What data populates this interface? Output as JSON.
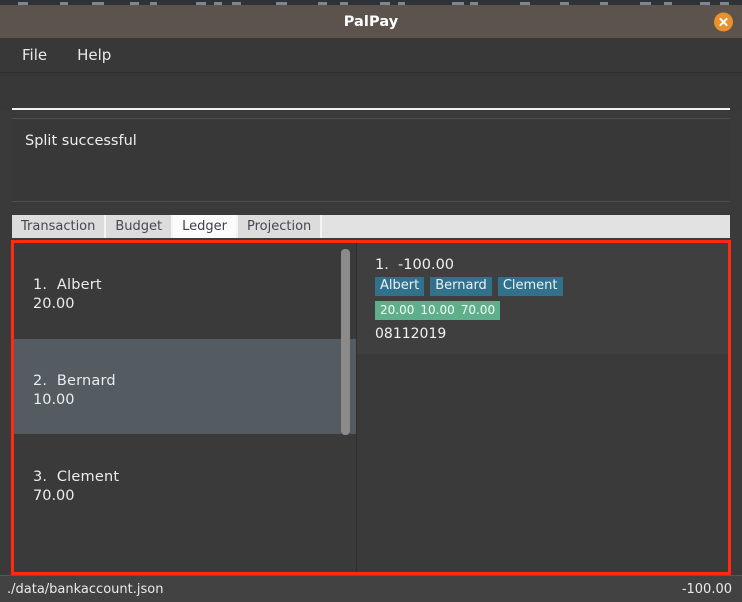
{
  "window": {
    "title": "PalPay",
    "close_icon": "close-icon"
  },
  "menu": {
    "items": [
      {
        "label": "File"
      },
      {
        "label": "Help"
      }
    ]
  },
  "command": {
    "value": "",
    "placeholder": ""
  },
  "message": {
    "text": "Split successful"
  },
  "tabs": [
    {
      "label": "Transaction",
      "selected": false
    },
    {
      "label": "Budget",
      "selected": false
    },
    {
      "label": "Ledger",
      "selected": true
    },
    {
      "label": "Projection",
      "selected": false
    }
  ],
  "ledger_list": {
    "rows": [
      {
        "title": "1.  Albert",
        "amount": "20.00",
        "selected": false
      },
      {
        "title": "2.  Bernard",
        "amount": "10.00",
        "selected": true
      },
      {
        "title": "3.  Clement",
        "amount": "70.00",
        "selected": false
      }
    ]
  },
  "transaction_detail": {
    "title": "1.  -100.00",
    "participants": [
      {
        "name": "Albert"
      },
      {
        "name": "Bernard"
      },
      {
        "name": "Clement"
      }
    ],
    "shares": [
      {
        "value": "20.00"
      },
      {
        "value": "10.00"
      },
      {
        "value": "70.00"
      }
    ],
    "date": "08112019"
  },
  "status_bar": {
    "file_path": "./data/bankaccount.json",
    "balance": "-100.00"
  },
  "colors": {
    "titlebar": "#5d534d",
    "close_button": "#e8912d",
    "highlight_border": "#ff2a10",
    "name_badge": "#31718c",
    "amount_badge": "#5fb08a",
    "selected_row": "#555c61"
  }
}
